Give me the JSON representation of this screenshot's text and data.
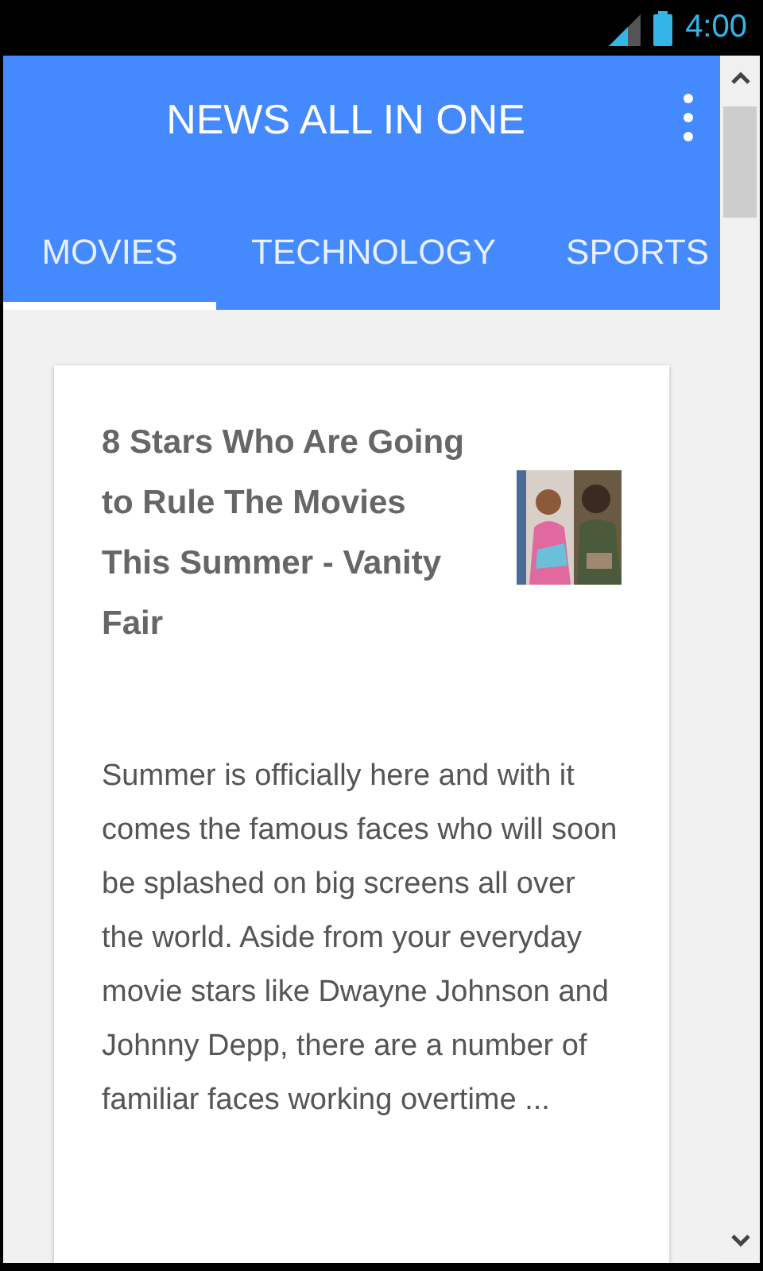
{
  "status_bar": {
    "time": "4:00"
  },
  "app_bar": {
    "title": "NEWS ALL IN ONE"
  },
  "tabs": [
    {
      "label": "MOVIES",
      "selected": true
    },
    {
      "label": "TECHNOLOGY",
      "selected": false
    },
    {
      "label": "SPORTS",
      "selected": false
    }
  ],
  "articles": [
    {
      "title": "8 Stars Who Are Going to Rule The Movies This Summer - Vanity Fair",
      "summary": "Summer is officially here and with it comes the famous faces who will soon be splashed on big screens all over the world. Aside from your everyday movie stars like Dwayne Johnson and Johnny Depp, there are a number of familiar faces working overtime ..."
    }
  ]
}
